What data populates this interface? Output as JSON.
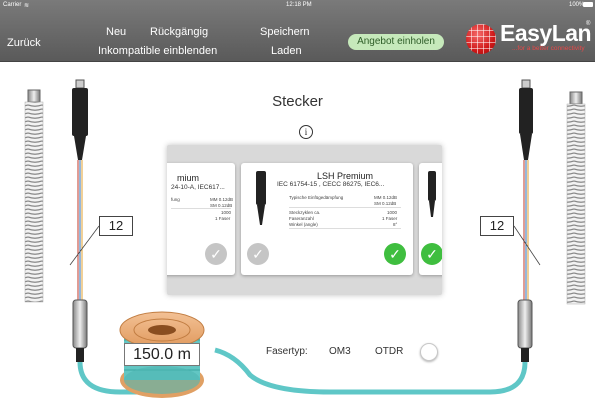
{
  "status_bar": {
    "carrier": "Carrier",
    "time": "12:18 PM",
    "battery": "100%"
  },
  "toolbar": {
    "back_label": "Zurück",
    "new_label": "Neu",
    "undo_label": "Rückgängig",
    "save_label": "Speichern",
    "incompatible_label": "Inkompatible einblenden",
    "load_label": "Laden",
    "quote_label": "Angebot einholen"
  },
  "logo": {
    "name": "EasyLan",
    "registered": "®",
    "tagline": "...for a better connectivity"
  },
  "main": {
    "title": "Stecker",
    "info_icon": "i"
  },
  "carousel": {
    "cards": [
      {
        "name": "mium",
        "standard": "24-10-A, IEC617...",
        "specs": [
          {
            "label": "fung",
            "value": "MM 0.12dB"
          },
          {
            "label": "",
            "value": "SM 0.12dB"
          },
          {
            "label": "",
            "value": "1000"
          },
          {
            "label": "",
            "value": "1 Faser"
          }
        ]
      },
      {
        "name": "LSH Premium",
        "standard": "IEC 61754-15 , CECC 86275, IEC6...",
        "specs": [
          {
            "label": "Typische Einfügedämpfung",
            "value": "MM 0.12dB"
          },
          {
            "label": "",
            "value": "SM 0.12dB"
          },
          {
            "label": "Steckzyklen ca.",
            "value": "1000"
          },
          {
            "label": "Faseranzahl",
            "value": "1 Faser"
          },
          {
            "label": "Winkel (angle)",
            "value": "8°"
          }
        ]
      }
    ],
    "check_icon": "✓"
  },
  "connectors": {
    "left_count": "12",
    "right_count": "12"
  },
  "cable": {
    "length": "150.0 m"
  },
  "fiber": {
    "label": "Fasertyp:",
    "value": "OM3",
    "otdr_label": "OTDR",
    "otdr_on": false
  },
  "colors": {
    "accent_green": "#3fbe3f",
    "cable": "#5fc7c7",
    "logo_red": "#d01818"
  }
}
